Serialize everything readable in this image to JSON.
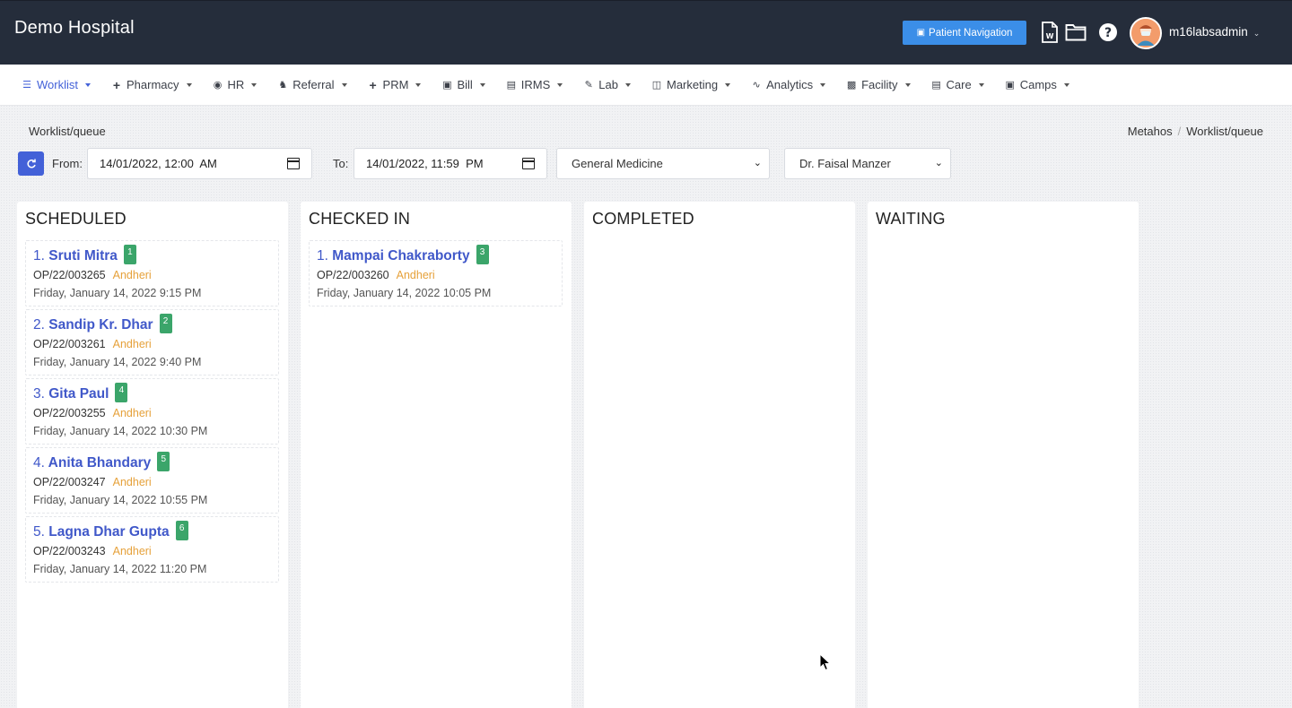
{
  "header": {
    "brand": "Demo Hospital",
    "patient_nav_label": "Patient Navigation",
    "username": "m16labsadmin"
  },
  "nav": {
    "items": [
      {
        "label": "Worklist",
        "icon": "list-icon"
      },
      {
        "label": "Pharmacy",
        "icon": "plus-icon"
      },
      {
        "label": "HR",
        "icon": "user-circle-icon"
      },
      {
        "label": "Referral",
        "icon": "users-icon"
      },
      {
        "label": "PRM",
        "icon": "plus-icon"
      },
      {
        "label": "Bill",
        "icon": "money-icon"
      },
      {
        "label": "IRMS",
        "icon": "id-card-icon"
      },
      {
        "label": "Lab",
        "icon": "pen-icon"
      },
      {
        "label": "Marketing",
        "icon": "bag-icon"
      },
      {
        "label": "Analytics",
        "icon": "pulse-icon"
      },
      {
        "label": "Facility",
        "icon": "building-icon"
      },
      {
        "label": "Care",
        "icon": "bed-icon"
      },
      {
        "label": "Camps",
        "icon": "briefcase-icon"
      }
    ]
  },
  "page": {
    "title": "Worklist/queue",
    "breadcrumb": [
      "Metahos",
      "Worklist/queue"
    ]
  },
  "filters": {
    "from_label": "From:",
    "from_value": "14/01/2022, 12:00  AM",
    "to_label": "To:",
    "to_value": "14/01/2022, 11:59  PM",
    "department": "General Medicine",
    "doctor": "Dr. Faisal Manzer"
  },
  "columns": [
    {
      "title": "SCHEDULED",
      "cards": [
        {
          "num": "1.",
          "name": "Sruti Mitra",
          "token": "1",
          "op": "OP/22/003265",
          "location": "Andheri",
          "datetime": "Friday, January 14, 2022 9:15 PM"
        },
        {
          "num": "2.",
          "name": "Sandip Kr. Dhar",
          "token": "2",
          "op": "OP/22/003261",
          "location": "Andheri",
          "datetime": "Friday, January 14, 2022 9:40 PM"
        },
        {
          "num": "3.",
          "name": "Gita Paul",
          "token": "4",
          "op": "OP/22/003255",
          "location": "Andheri",
          "datetime": "Friday, January 14, 2022 10:30 PM"
        },
        {
          "num": "4.",
          "name": "Anita Bhandary",
          "token": "5",
          "op": "OP/22/003247",
          "location": "Andheri",
          "datetime": "Friday, January 14, 2022 10:55 PM"
        },
        {
          "num": "5.",
          "name": "Lagna Dhar Gupta",
          "token": "6",
          "op": "OP/22/003243",
          "location": "Andheri",
          "datetime": "Friday, January 14, 2022 11:20 PM"
        }
      ]
    },
    {
      "title": "CHECKED IN",
      "cards": [
        {
          "num": "1.",
          "name": "Mampai Chakraborty",
          "token": "3",
          "op": "OP/22/003260",
          "location": "Andheri",
          "datetime": "Friday, January 14, 2022 10:05 PM"
        }
      ]
    },
    {
      "title": "COMPLETED",
      "cards": []
    },
    {
      "title": "WAITING",
      "cards": []
    }
  ],
  "colors": {
    "header_bg": "#252d3b",
    "accent": "#4361d8",
    "badge": "#3ba56a",
    "location": "#e6a13a"
  }
}
